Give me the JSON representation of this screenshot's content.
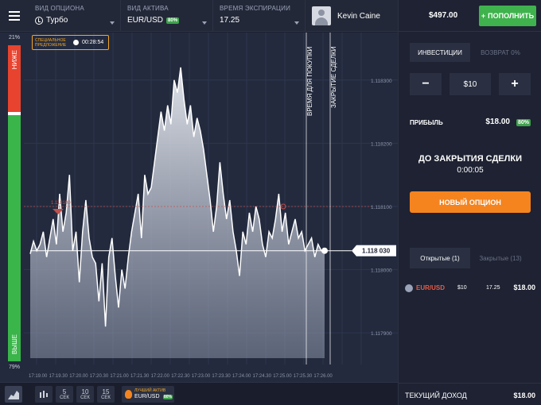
{
  "topbar": {
    "option_type": {
      "label": "ВИД ОПЦИОНА",
      "value": "Турбо"
    },
    "asset_type": {
      "label": "ВИД АКТИВА",
      "value": "EUR/USD",
      "badge": "80%"
    },
    "expiration": {
      "label": "ВРЕМЯ ЭКСПИРАЦИИ",
      "value": "17.25"
    },
    "user": {
      "name": "Kevin Caine"
    }
  },
  "account": {
    "balance": "$497.00",
    "deposit_label": "ПОПОЛНИТЬ"
  },
  "trade_panel": {
    "tabs": [
      "ИНВЕСТИЦИИ",
      "ВОЗВРАТ 0%"
    ],
    "minus": "−",
    "plus": "+",
    "amount": "$10",
    "profit_label": "ПРИБЫЛЬ",
    "profit_value": "$18.00",
    "profit_badge": "80%",
    "countdown_title": "ДО ЗАКРЫТИЯ СДЕЛКИ",
    "countdown_time": "0:00:05",
    "new_option_label": "НОВЫЙ ОПЦИОН"
  },
  "deals": {
    "tabs": [
      "Открытые (1)",
      "Закрытые (13)"
    ],
    "rows": [
      {
        "asset": "EUR/USD",
        "investment": "$10",
        "time": "17.25",
        "result": "$18.00"
      }
    ]
  },
  "income": {
    "label": "ТЕКУЩИЙ ДОХОД",
    "value": "$18.00"
  },
  "meter": {
    "top_pct": "21%",
    "bottom_pct": "79%",
    "down_label": "НИЖЕ",
    "up_label": "ВЫШЕ",
    "down_fraction": 0.21
  },
  "offer": {
    "text": "СПЕЦИАЛЬНОЕ ПРЕДЛОЖЕНИЕ",
    "time": "00:28:54"
  },
  "chart_labels": {
    "purchase_time": "ВРЕМЯ ДЛЯ ПОКУПКИ",
    "deal_close": "ЗАКРЫТИЕ СДЕЛКИ",
    "current_price": "1.118 030",
    "entry_price": "1.118100"
  },
  "chart_data": {
    "type": "area",
    "y_ticks": [
      "1.118300",
      "1.118200",
      "1.118100",
      "1.118000",
      "1.117900"
    ],
    "x_ticks": [
      "17:19.00",
      "17:19.30",
      "17:20.00",
      "17:20.30",
      "17:21.00",
      "17:21.30",
      "17:22.00",
      "17:22.30",
      "17:23.00",
      "17:23.30",
      "17:24.00",
      "17:24.30",
      "17:25.00",
      "17:25.30",
      "17:26.00"
    ],
    "ylim": [
      1.11786,
      1.11835
    ],
    "entry_level": 1.1181,
    "current_level": 1.11803,
    "values": [
      1.118025,
      1.118045,
      1.11803,
      1.11804,
      1.11806,
      1.11802,
      1.11805,
      1.11808,
      1.11804,
      1.11812,
      1.11806,
      1.11809,
      1.11815,
      1.11803,
      1.11806,
      1.11798,
      1.11806,
      1.11811,
      1.11805,
      1.11802,
      1.11801,
      1.11795,
      1.11801,
      1.11791,
      1.11802,
      1.11805,
      1.11799,
      1.11794,
      1.118,
      1.11797,
      1.11802,
      1.11806,
      1.11809,
      1.11812,
      1.11805,
      1.11815,
      1.11812,
      1.11813,
      1.11817,
      1.11821,
      1.11825,
      1.11822,
      1.11826,
      1.11823,
      1.1183,
      1.11828,
      1.11832,
      1.11827,
      1.11823,
      1.11826,
      1.11821,
      1.11824,
      1.11822,
      1.11819,
      1.11815,
      1.11811,
      1.11806,
      1.1181,
      1.11817,
      1.11812,
      1.11808,
      1.11811,
      1.11806,
      1.11803,
      1.11799,
      1.11806,
      1.11804,
      1.11809,
      1.11806,
      1.1181,
      1.11808,
      1.11804,
      1.11802,
      1.11806,
      1.11805,
      1.11808,
      1.11812,
      1.11806,
      1.11809,
      1.11804,
      1.11806,
      1.11808,
      1.11805,
      1.11806,
      1.11803,
      1.11804,
      1.11805,
      1.11802,
      1.11804,
      1.11803,
      1.11803
    ],
    "x_range": [
      "17:18.30",
      "17:25.05"
    ]
  },
  "bottombar": {
    "intervals": [
      {
        "n": "5",
        "u": "СЕК"
      },
      {
        "n": "10",
        "u": "СЕК"
      },
      {
        "n": "15",
        "u": "СЕК"
      }
    ],
    "best_asset_label": "ЛУЧШИЙ АКТИВ",
    "best_asset": "EUR/USD",
    "best_badge": "80%"
  },
  "colors": {
    "up": "#39b54a",
    "down": "#e8432e",
    "accent": "#f5841f",
    "bg": "#232a3d"
  }
}
